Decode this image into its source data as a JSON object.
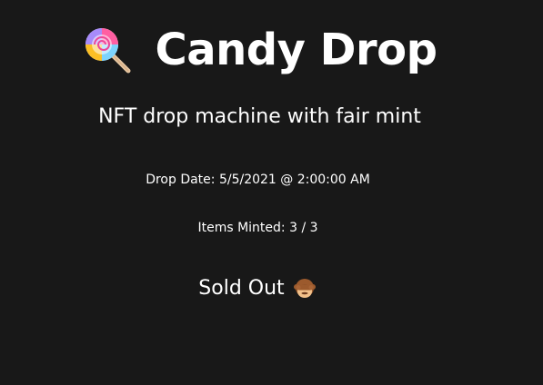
{
  "app": {
    "title": "Candy Drop",
    "subtitle": "NFT drop machine with fair mint",
    "logo_icon": "lollipop-icon"
  },
  "drop": {
    "date_label": "Drop Date:",
    "date_value": "5/5/2021 @ 2:00:00 AM",
    "minted_label": "Items Minted:",
    "minted_value": "3 / 3",
    "minted_count": 3,
    "total_count": 3
  },
  "status": {
    "label": "Sold Out",
    "icon": "see-no-evil-monkey-icon"
  },
  "colors": {
    "background": "#181818",
    "text": "#ffffff",
    "lollipop_stick": "#e7c7a2",
    "monkey_fur": "#9c5a2d",
    "monkey_face": "#f1c08a"
  }
}
